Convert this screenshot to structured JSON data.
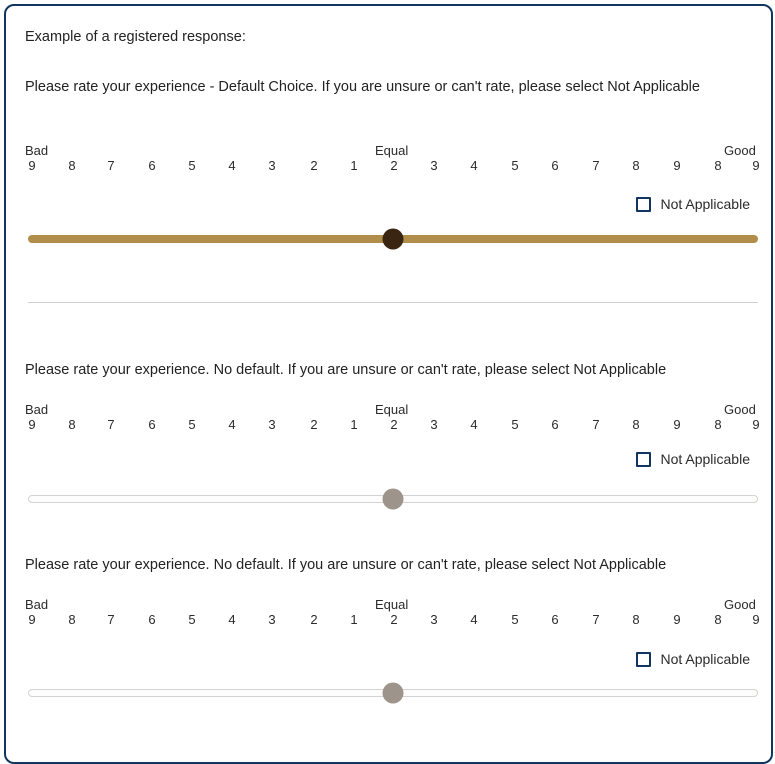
{
  "card": {
    "border_color": "#10355e",
    "background": "#ffffff"
  },
  "intro": {
    "text": "Example of a registered response:"
  },
  "scale": {
    "anchor_left": "Bad",
    "anchor_center": "Equal",
    "anchor_right": "Good",
    "ticks": [
      "9",
      "8",
      "7",
      "6",
      "5",
      "4",
      "3",
      "2",
      "1",
      "2",
      "3",
      "4",
      "5",
      "6",
      "7",
      "8",
      "9",
      "8",
      "9"
    ]
  },
  "questions": [
    {
      "text": "Please rate your experience - Default Choice. If you are unsure or can't rate, please select Not Applicable",
      "na_label": "Not Applicable",
      "na_checked": false,
      "slider": {
        "state": "answered",
        "value_percent": 50,
        "track_color": "#b08e4a",
        "thumb_color": "#3a2512"
      }
    },
    {
      "text": "Please rate your experience. No default. If you are unsure or can't rate, please select Not Applicable",
      "na_label": "Not Applicable",
      "na_checked": false,
      "slider": {
        "state": "default",
        "value_percent": 50,
        "track_color": "#fdfdfd",
        "thumb_color": "#9d948c"
      }
    },
    {
      "text": "Please rate your experience. No default. If you are unsure or can't rate, please select Not Applicable",
      "na_label": "Not Applicable",
      "na_checked": false,
      "slider": {
        "state": "default",
        "value_percent": 50,
        "track_color": "#fdfdfd",
        "thumb_color": "#9d948c"
      }
    }
  ]
}
